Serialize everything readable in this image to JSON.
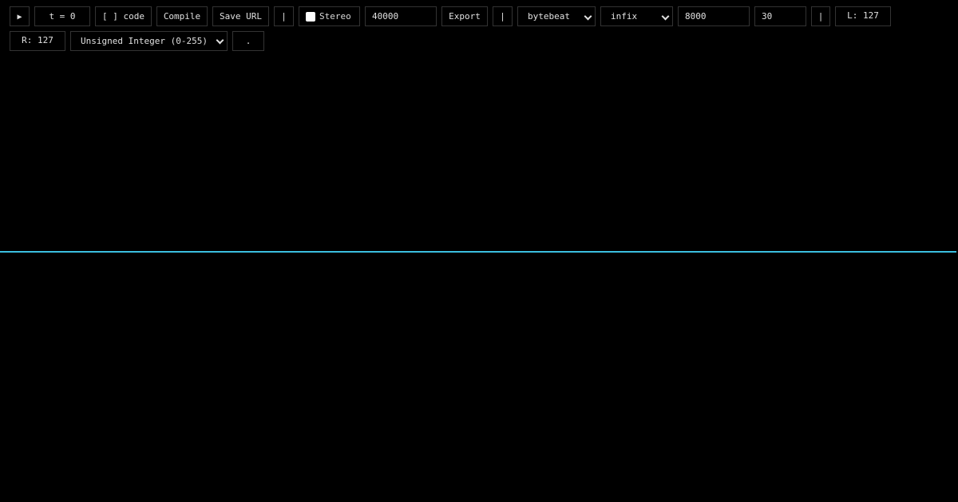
{
  "toolbar": {
    "play_glyph": "▶",
    "play_icon": "play-icon",
    "time": "t = 0",
    "code_toggle": "[ ] code",
    "compile": "Compile",
    "save_url": "Save URL",
    "separator": "|",
    "stereo_label": "Stereo",
    "stereo_checked": false,
    "length_value": "40000",
    "export": "Export",
    "mode_select": "bytebeat",
    "notation_select": "infix",
    "sample_rate_value": "8000",
    "fps_value": "30",
    "left_readout": "L: 127",
    "right_readout": "R: 127",
    "sample_format_select": "Unsigned Integer (0-255)",
    "extra_button": "."
  },
  "scope": {
    "left_level": 127,
    "right_level": 127,
    "range_max": 255,
    "trace_color": "#3bbfe0",
    "background": "#000000"
  }
}
